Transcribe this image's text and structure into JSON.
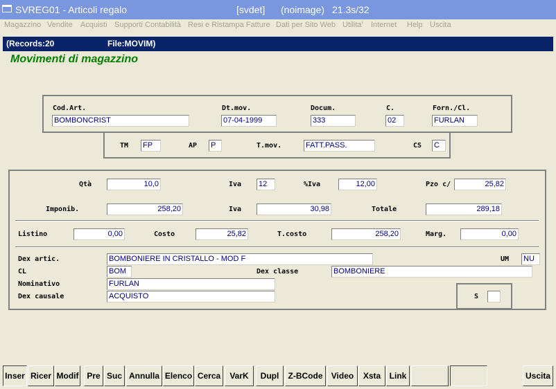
{
  "titlebar": {
    "app": "SVREG01 - Articoli regalo",
    "session": "[svdet]",
    "image": "(noimage)",
    "timing": "21.3s/32"
  },
  "menu": [
    "Magazzino",
    "Vendite",
    "Acquisti",
    "Supporti Contabilità",
    "Resi e Ristampa Fatture",
    "Dati per Sito Web",
    "Utilita'",
    "Internet",
    "Help",
    "Uscita"
  ],
  "infobar": {
    "records": "(Records:20",
    "file": "File:MOVIM)"
  },
  "heading": "Movimenti di magazzino",
  "header": {
    "cod_art_label": "Cod.Art.",
    "cod_art": "BOMBONCRIST",
    "dt_mov_label": "Dt.mov.",
    "dt_mov": "07-04-1999",
    "docum_label": "Docum.",
    "docum": "333",
    "c_label": "C.",
    "c": "02",
    "forn_label": "Forn./Cl.",
    "forn": "FURLAN"
  },
  "movement": {
    "tm_label": "TM",
    "tm": "FP",
    "ap_label": "AP",
    "ap": "P",
    "tmov_label": "T.mov.",
    "tmov": "FATT.PASS.",
    "cs_label": "CS",
    "cs": "C"
  },
  "amounts": {
    "qta_label": "Qtà",
    "qta": "10,0",
    "iva_label": "Iva",
    "iva": "12",
    "piva_label": "%Iva",
    "piva": "12,00",
    "pzo_label": "Pzo c/",
    "pzo": "25,82",
    "imponib_label": "Imponib.",
    "imponib": "258,20",
    "iva2_label": "Iva",
    "iva2": "30,98",
    "totale_label": "Totale",
    "totale": "289,18",
    "listino_label": "Listino",
    "listino": "0,00",
    "costo_label": "Costo",
    "costo": "25,82",
    "tcosto_label": "T.costo",
    "tcosto": "258,20",
    "marg_label": "Marg.",
    "marg": "0,00"
  },
  "details": {
    "dex_artic_label": "Dex artic.",
    "dex_artic": "BOMBONIERE IN CRISTALLO - MOD F",
    "um_label": "UM",
    "um": "NU",
    "cl_label": "CL",
    "cl": "BOM",
    "dex_classe_label": "Dex classe",
    "dex_classe": "BOMBONIERE",
    "nominativo_label": "Nominativo",
    "nominativo": "FURLAN",
    "dex_causale_label": "Dex causale",
    "dex_causale": "ACQUISTO",
    "s_label": "S",
    "s": ""
  },
  "buttons": [
    "Inser",
    "Ricer",
    "Modif",
    "Pre",
    "Suc",
    "Annulla",
    "Elenco",
    "Cerca",
    "VarK",
    "Dupl",
    "Z-BCode",
    "Video",
    "Xsta",
    "Link",
    "",
    "",
    "Uscita"
  ]
}
